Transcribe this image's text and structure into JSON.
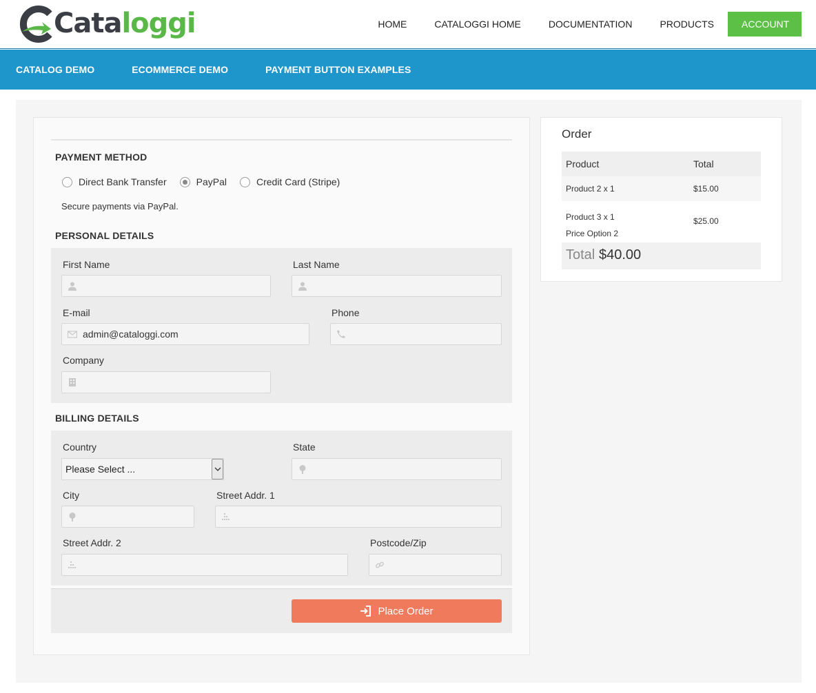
{
  "brand": {
    "logo_text_dark": "Cata",
    "logo_text_green": "loggi"
  },
  "topnav": {
    "items": [
      "HOME",
      "CATALOGGI HOME",
      "DOCUMENTATION",
      "PRODUCTS"
    ],
    "account": "ACCOUNT"
  },
  "subnav": {
    "items": [
      "CATALOG DEMO",
      "ECOMMERCE DEMO",
      "PAYMENT BUTTON EXAMPLES"
    ]
  },
  "payment": {
    "title": "PAYMENT METHOD",
    "options": [
      "Direct Bank Transfer",
      "PayPal",
      "Credit Card (Stripe)"
    ],
    "selected": "PayPal",
    "description": "Secure payments via PayPal."
  },
  "personal": {
    "title": "PERSONAL DETAILS",
    "first_name_label": "First Name",
    "last_name_label": "Last Name",
    "email_label": "E-mail",
    "email_value": "admin@cataloggi.com",
    "phone_label": "Phone",
    "company_label": "Company"
  },
  "billing": {
    "title": "BILLING DETAILS",
    "country_label": "Country",
    "country_value": "Please Select ...",
    "state_label": "State",
    "city_label": "City",
    "street1_label": "Street Addr. 1",
    "street2_label": "Street Addr. 2",
    "postcode_label": "Postcode/Zip"
  },
  "place_order": "Place Order",
  "order": {
    "title": "Order",
    "header_product": "Product",
    "header_total": "Total",
    "rows": [
      {
        "product": "Product 2 x 1",
        "option": "",
        "total": "$15.00"
      },
      {
        "product": "Product 3 x 1",
        "option": "Price Option 2",
        "total": "$25.00"
      }
    ],
    "total_label": "Total",
    "total_value": "$40.00"
  },
  "colors": {
    "accent_blue": "#1e96cb",
    "account_green": "#5cbf46",
    "place_order": "#ef7a5c"
  }
}
